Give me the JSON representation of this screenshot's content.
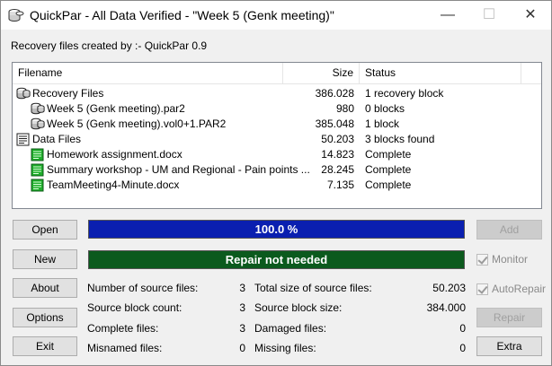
{
  "window": {
    "title": "QuickPar - All Data Verified - \"Week 5 (Genk meeting)\"",
    "min_glyph": "—",
    "max_glyph": "☐",
    "close_glyph": "✕"
  },
  "created_by": "Recovery files created by :- QuickPar 0.9",
  "table": {
    "columns": [
      "Filename",
      "Size",
      "Status"
    ],
    "rows": [
      {
        "name": "Recovery Files",
        "size": "386.028",
        "status": "1 recovery block",
        "icon": "recovery-group-icon",
        "indent": 0
      },
      {
        "name": "Week 5 (Genk meeting).par2",
        "size": "980",
        "status": "0 blocks",
        "icon": "par2-file-icon",
        "indent": 1
      },
      {
        "name": "Week 5 (Genk meeting).vol0+1.PAR2",
        "size": "385.048",
        "status": "1 block",
        "icon": "par2-file-icon",
        "indent": 1
      },
      {
        "name": "Data Files",
        "size": "50.203",
        "status": "3 blocks found",
        "icon": "data-group-icon",
        "indent": 0
      },
      {
        "name": "Homework assignment.docx",
        "size": "14.823",
        "status": "Complete",
        "icon": "complete-file-icon",
        "indent": 1
      },
      {
        "name": "Summary workshop - UM and Regional - Pain points ...",
        "size": "28.245",
        "status": "Complete",
        "icon": "complete-file-icon",
        "indent": 1
      },
      {
        "name": "TeamMeeting4-Minute.docx",
        "size": "7.135",
        "status": "Complete",
        "icon": "complete-file-icon",
        "indent": 1
      }
    ]
  },
  "buttons": {
    "open": "Open",
    "new": "New",
    "about": "About",
    "options": "Options",
    "exit": "Exit",
    "add": "Add",
    "repair": "Repair",
    "extra": "Extra"
  },
  "progress": {
    "text": "100.0 %",
    "fraction": 1.0,
    "color": "#0a1fb0"
  },
  "status_bar": {
    "text": "Repair not needed",
    "fraction": 1.0,
    "color": "#0b5a1d"
  },
  "checkboxes": {
    "monitor": "Monitor",
    "autorepair": "AutoRepair"
  },
  "stats": {
    "num_source_files_label": "Number of source files:",
    "num_source_files": "3",
    "source_block_count_label": "Source block count:",
    "source_block_count": "3",
    "complete_files_label": "Complete files:",
    "complete_files": "3",
    "misnamed_files_label": "Misnamed files:",
    "misnamed_files": "0",
    "total_size_label": "Total size of source files:",
    "total_size": "50.203",
    "source_block_size_label": "Source block size:",
    "source_block_size": "384.000",
    "damaged_files_label": "Damaged files:",
    "damaged_files": "0",
    "missing_files_label": "Missing files:",
    "missing_files": "0"
  }
}
